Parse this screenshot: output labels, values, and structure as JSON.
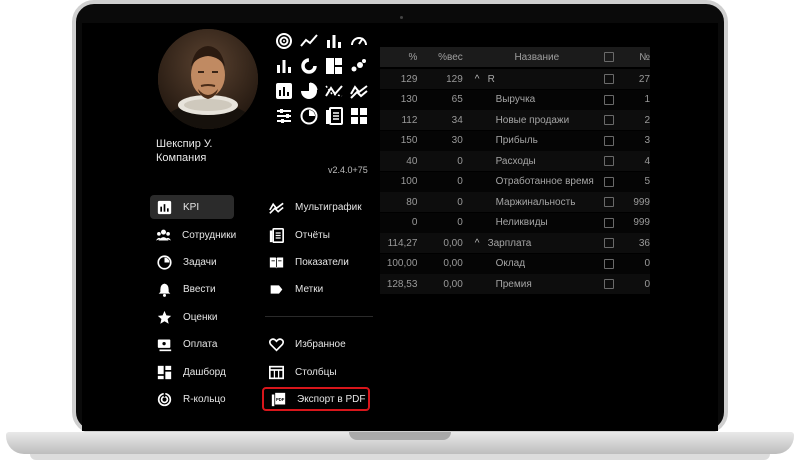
{
  "profile": {
    "name": "Шекспир У.",
    "company": "Компания",
    "version": "v2.4.0+75"
  },
  "icon_grid": [
    "ring-chart-icon",
    "line-chart-icon",
    "bar-chart-icon",
    "gauge-icon",
    "bar-chart-icon",
    "donut-chart-icon",
    "treemap-icon",
    "scatter-icon",
    "kpi-icon",
    "pie-chart-icon",
    "trend-icon",
    "multichart-icon",
    "sliders-icon",
    "clock-icon",
    "report-icon",
    "grid-icon"
  ],
  "menu_left": [
    {
      "label": "KPI",
      "icon": "kpi-icon",
      "active": true
    },
    {
      "label": "Сотрудники",
      "icon": "people-icon"
    },
    {
      "label": "Задачи",
      "icon": "clock-icon"
    },
    {
      "label": "Ввести",
      "icon": "bell-icon"
    },
    {
      "label": "Оценки",
      "icon": "star-icon"
    },
    {
      "label": "Оплата",
      "icon": "payment-icon"
    },
    {
      "label": "Дашборд",
      "icon": "dashboard-icon"
    },
    {
      "label": "R-кольцо",
      "icon": "ring-icon"
    }
  ],
  "menu_right": [
    {
      "label": "Мультиграфик",
      "icon": "multichart-icon"
    },
    {
      "label": "Отчёты",
      "icon": "report-icon"
    },
    {
      "label": "Показатели",
      "icon": "book-icon"
    },
    {
      "label": "Метки",
      "icon": "tag-icon"
    },
    {
      "label": "Избранное",
      "icon": "heart-icon"
    },
    {
      "label": "Столбцы",
      "icon": "columns-icon"
    },
    {
      "label": "Экспорт в PDF",
      "icon": "pdf-icon",
      "highlighted": true
    }
  ],
  "table": {
    "headers": {
      "pct": "%",
      "weight": "%вес",
      "name": "Название",
      "num": "№"
    },
    "rows": [
      {
        "pct": "129",
        "weight": "129",
        "name": "R",
        "num": "27",
        "group": true
      },
      {
        "pct": "130",
        "weight": "65",
        "name": "Выручка",
        "num": "1"
      },
      {
        "pct": "112",
        "weight": "34",
        "name": "Новые продажи",
        "num": "2"
      },
      {
        "pct": "150",
        "weight": "30",
        "name": "Прибыль",
        "num": "3"
      },
      {
        "pct": "40",
        "weight": "0",
        "name": "Расходы",
        "num": "4"
      },
      {
        "pct": "100",
        "weight": "0",
        "name": "Отработанное время",
        "num": "5"
      },
      {
        "pct": "80",
        "weight": "0",
        "name": "Маржинальность",
        "num": "999"
      },
      {
        "pct": "0",
        "weight": "0",
        "name": "Неликвиды",
        "num": "999"
      },
      {
        "pct": "114,27",
        "weight": "0,00",
        "name": "Зарплата",
        "num": "36",
        "group": true
      },
      {
        "pct": "100,00",
        "weight": "0,00",
        "name": "Оклад",
        "num": "0"
      },
      {
        "pct": "128,53",
        "weight": "0,00",
        "name": "Премия",
        "num": "0"
      }
    ]
  },
  "colors": {
    "highlight": "#d8161b",
    "screen": "#000000"
  }
}
